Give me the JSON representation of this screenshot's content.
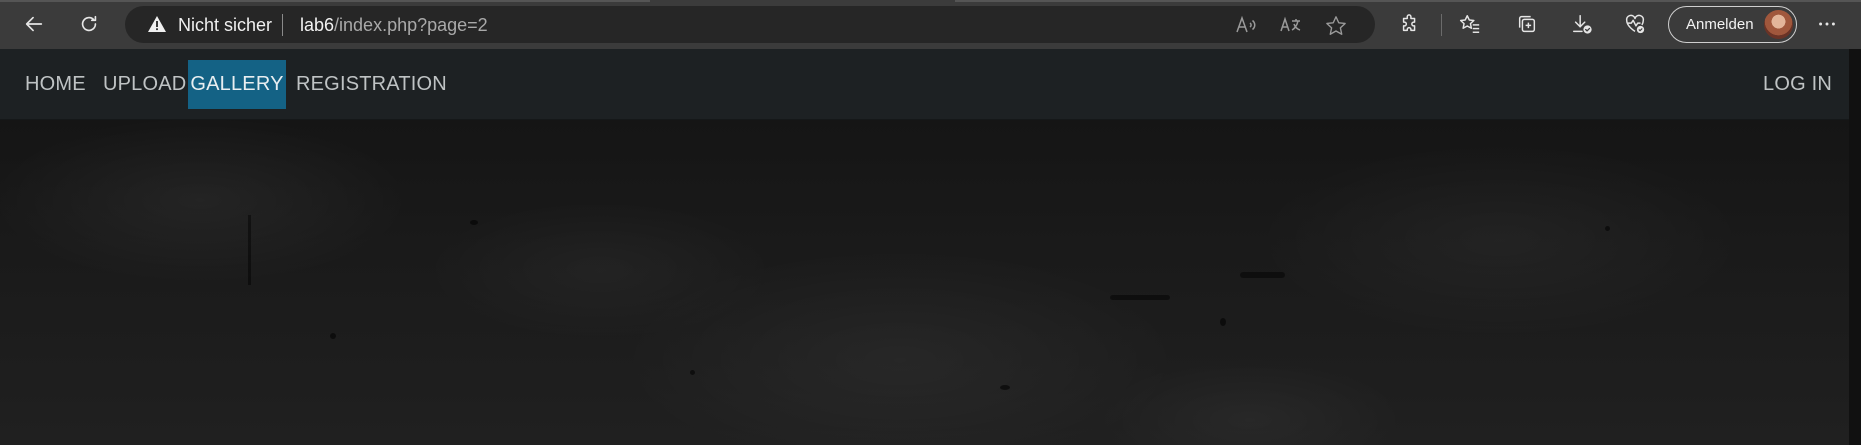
{
  "browser": {
    "security_label": "Nicht sicher",
    "url_host": "lab6",
    "url_path": "/index.php?page=2",
    "signin_label": "Anmelden"
  },
  "icons": {
    "back": "back-arrow-icon",
    "refresh": "refresh-icon",
    "warning": "warning-triangle-icon",
    "read_aloud": "read-aloud-icon",
    "translate": "translate-icon",
    "favorite": "star-icon",
    "extensions": "puzzle-icon",
    "favorites": "favorites-list-icon",
    "collections": "collections-icon",
    "downloads": "download-icon",
    "health": "browser-essentials-icon",
    "more": "more-dots-icon"
  },
  "nav": {
    "items": [
      {
        "label": "HOME"
      },
      {
        "label": "UPLOAD"
      },
      {
        "label": "GALLERY",
        "active": true
      },
      {
        "label": "REGISTRATION"
      }
    ],
    "login_label": "LOG IN"
  },
  "colors": {
    "nav_background": "#1d2123",
    "active_tab": "#146285",
    "browser_chrome": "#3b3b3b"
  }
}
